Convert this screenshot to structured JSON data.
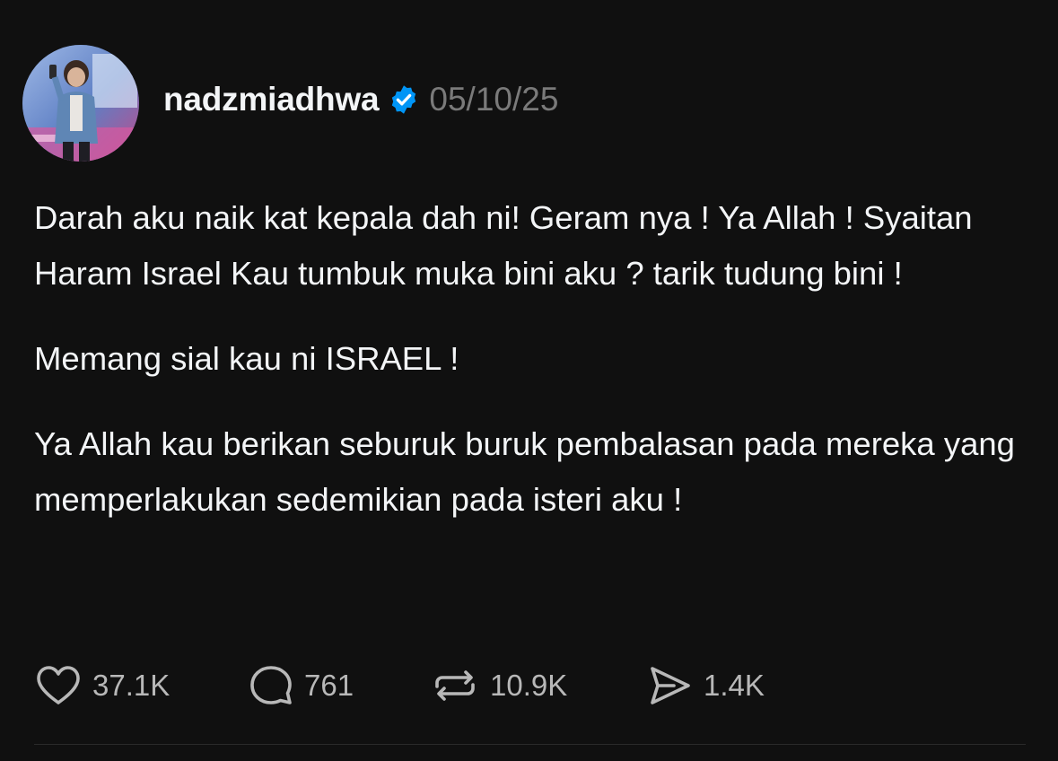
{
  "post": {
    "username": "nadzmiadhwa",
    "timestamp": "05/10/25",
    "paragraphs": [
      "Darah aku naik kat kepala dah ni! Geram nya ! Ya Allah ! Syaitan Haram Israel Kau tumbuk muka bini aku ? tarik tudung bini !",
      "Memang sial kau ni ISRAEL !",
      "Ya Allah kau berikan seburuk buruk pembalasan pada mereka yang memperlakukan sedemikian pada isteri aku !"
    ],
    "actions": {
      "likes": "37.1K",
      "replies": "761",
      "reposts": "10.9K",
      "shares": "1.4K"
    }
  },
  "icons": {
    "avatar": "profile-photo",
    "verified": "verified-badge-icon",
    "like": "heart-icon",
    "reply": "speech-bubble-icon",
    "repost": "repost-arrows-icon",
    "share": "paper-plane-icon"
  },
  "colors": {
    "background": "#101010",
    "text": "#f3f5f7",
    "muted": "#7a7a7a",
    "verified": "#0095f6"
  }
}
